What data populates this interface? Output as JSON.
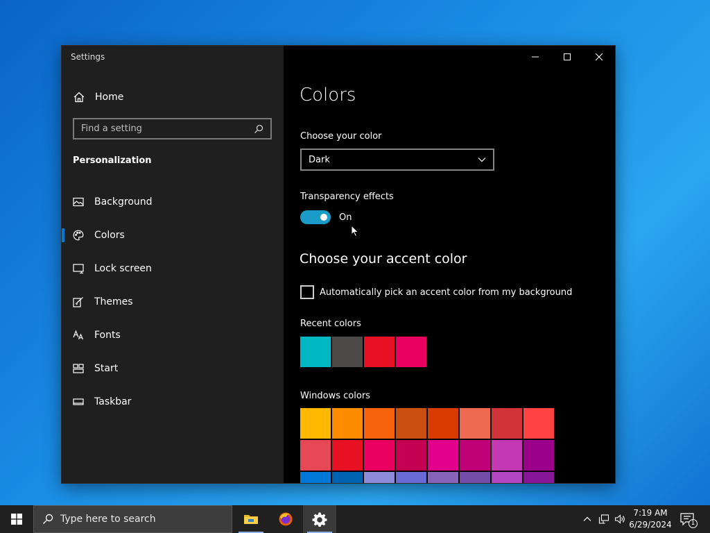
{
  "window": {
    "app_title": "Settings",
    "caption": {
      "minimize_icon": "minimize-icon",
      "maximize_icon": "maximize-icon",
      "close_icon": "close-icon"
    }
  },
  "sidebar": {
    "home_label": "Home",
    "search_placeholder": "Find a setting",
    "section_heading": "Personalization",
    "items": [
      {
        "label": "Background",
        "icon": "image-icon",
        "active": false
      },
      {
        "label": "Colors",
        "icon": "palette-icon",
        "active": true
      },
      {
        "label": "Lock screen",
        "icon": "lock-screen-icon",
        "active": false
      },
      {
        "label": "Themes",
        "icon": "themes-brush-icon",
        "active": false
      },
      {
        "label": "Fonts",
        "icon": "fonts-icon",
        "active": false
      },
      {
        "label": "Start",
        "icon": "start-tiles-icon",
        "active": false
      },
      {
        "label": "Taskbar",
        "icon": "taskbar-icon",
        "active": false
      }
    ]
  },
  "main": {
    "title": "Colors",
    "choose_color_label": "Choose your color",
    "choose_color_value": "Dark",
    "transparency_label": "Transparency effects",
    "transparency_state": "On",
    "transparency_on": true,
    "accent_heading": "Choose your accent color",
    "auto_accent_label": "Automatically pick an accent color from my background",
    "auto_accent_checked": false,
    "recent_colors_label": "Recent colors",
    "recent_colors": [
      "#00b7c3",
      "#4c4a48",
      "#e81123",
      "#ea005e"
    ],
    "windows_colors_label": "Windows colors",
    "windows_colors": [
      "#ffb900",
      "#ff8c00",
      "#f7630c",
      "#ca5010",
      "#da3b01",
      "#ef6950",
      "#d13438",
      "#ff4343",
      "#e74856",
      "#e81123",
      "#ea005e",
      "#c30052",
      "#e3008c",
      "#bf0077",
      "#c239b3",
      "#9a0089",
      "#0078d7",
      "#0063b1",
      "#8e8cd8",
      "#6b69d6",
      "#8764b8",
      "#744da9",
      "#b146c2",
      "#881798"
    ]
  },
  "taskbar": {
    "search_placeholder": "Type here to search",
    "apps": [
      {
        "name": "file-explorer",
        "icon": "folder-icon"
      },
      {
        "name": "firefox",
        "icon": "firefox-icon"
      },
      {
        "name": "settings",
        "icon": "gear-icon"
      }
    ],
    "time": "7:19 AM",
    "date": "6/29/2024",
    "notification_count": "1"
  }
}
